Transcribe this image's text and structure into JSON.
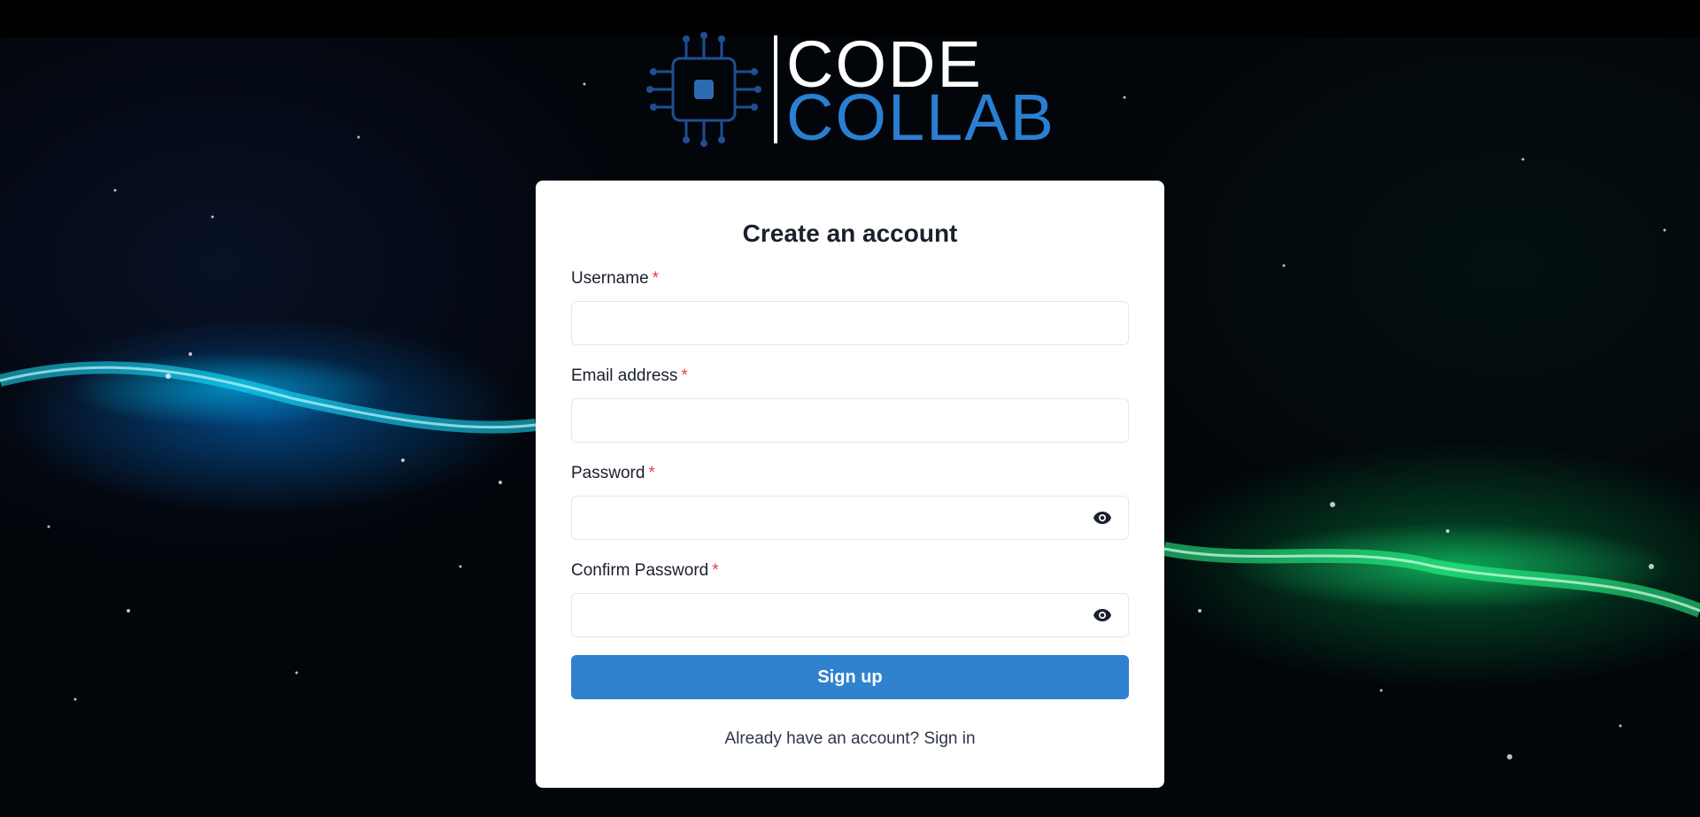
{
  "colors": {
    "background": "#02050a",
    "left_nebula": "#00c8ff",
    "right_nebula": "#20f080",
    "logo_top": "#ffffff",
    "logo_bottom": "#2a7fd1",
    "primary_button": "#3182ce",
    "required_marker": "#e53e3e"
  },
  "logo": {
    "word_top": "CODE",
    "word_bottom": "COLLAB",
    "icon": "circuit-chip-icon"
  },
  "form": {
    "title": "Create an account",
    "required_marker": "*",
    "fields": [
      {
        "label": "Username",
        "value": "",
        "type": "text"
      },
      {
        "label": "Email address",
        "value": "",
        "type": "email"
      },
      {
        "label": "Password",
        "value": "",
        "type": "password",
        "icon": "eye-icon"
      },
      {
        "label": "Confirm Password",
        "value": "",
        "type": "password",
        "icon": "eye-icon"
      }
    ],
    "submit_label": "Sign up",
    "footer_text": "Already have an account?",
    "footer_link": "Sign in"
  }
}
